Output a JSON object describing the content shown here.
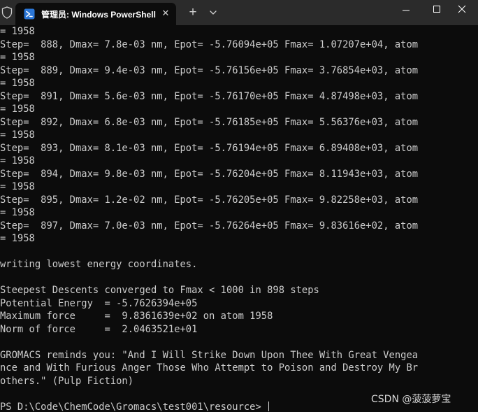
{
  "window": {
    "tab_title": "管理员: Windows PowerShell",
    "tab_close_glyph": "✕",
    "new_tab_glyph": "+",
    "tab_icon": "powershell-icon",
    "security_icon": "shield-icon"
  },
  "colors": {
    "titlebar_bg": "#2b2b2b",
    "terminal_bg": "#0c0c0c",
    "terminal_text": "#cccccc"
  },
  "terminal": {
    "lines": [
      "= 1958",
      "Step=  888, Dmax= 7.8e-03 nm, Epot= -5.76094e+05 Fmax= 1.07207e+04, atom",
      "= 1958",
      "Step=  889, Dmax= 9.4e-03 nm, Epot= -5.76156e+05 Fmax= 3.76854e+03, atom",
      "= 1958",
      "Step=  891, Dmax= 5.6e-03 nm, Epot= -5.76170e+05 Fmax= 4.87498e+03, atom",
      "= 1958",
      "Step=  892, Dmax= 6.8e-03 nm, Epot= -5.76185e+05 Fmax= 5.56376e+03, atom",
      "= 1958",
      "Step=  893, Dmax= 8.1e-03 nm, Epot= -5.76194e+05 Fmax= 6.89408e+03, atom",
      "= 1958",
      "Step=  894, Dmax= 9.8e-03 nm, Epot= -5.76204e+05 Fmax= 8.11943e+03, atom",
      "= 1958",
      "Step=  895, Dmax= 1.2e-02 nm, Epot= -5.76205e+05 Fmax= 9.82258e+03, atom",
      "= 1958",
      "Step=  897, Dmax= 7.0e-03 nm, Epot= -5.76264e+05 Fmax= 9.83616e+02, atom",
      "= 1958",
      "",
      "writing lowest energy coordinates.",
      "",
      "Steepest Descents converged to Fmax < 1000 in 898 steps",
      "Potential Energy  = -5.7626394e+05",
      "Maximum force     =  9.8361639e+02 on atom 1958",
      "Norm of force     =  2.0463521e+01",
      "",
      "GROMACS reminds you: \"And I Will Strike Down Upon Thee With Great Vengea",
      "nce and With Furious Anger Those Who Attempt to Poison and Destroy My Br",
      "others.\" (Pulp Fiction)",
      ""
    ],
    "prompt": "PS D:\\Code\\ChemCode\\Gromacs\\test001\\resource> "
  },
  "watermark": "CSDN @菠菠萝宝"
}
